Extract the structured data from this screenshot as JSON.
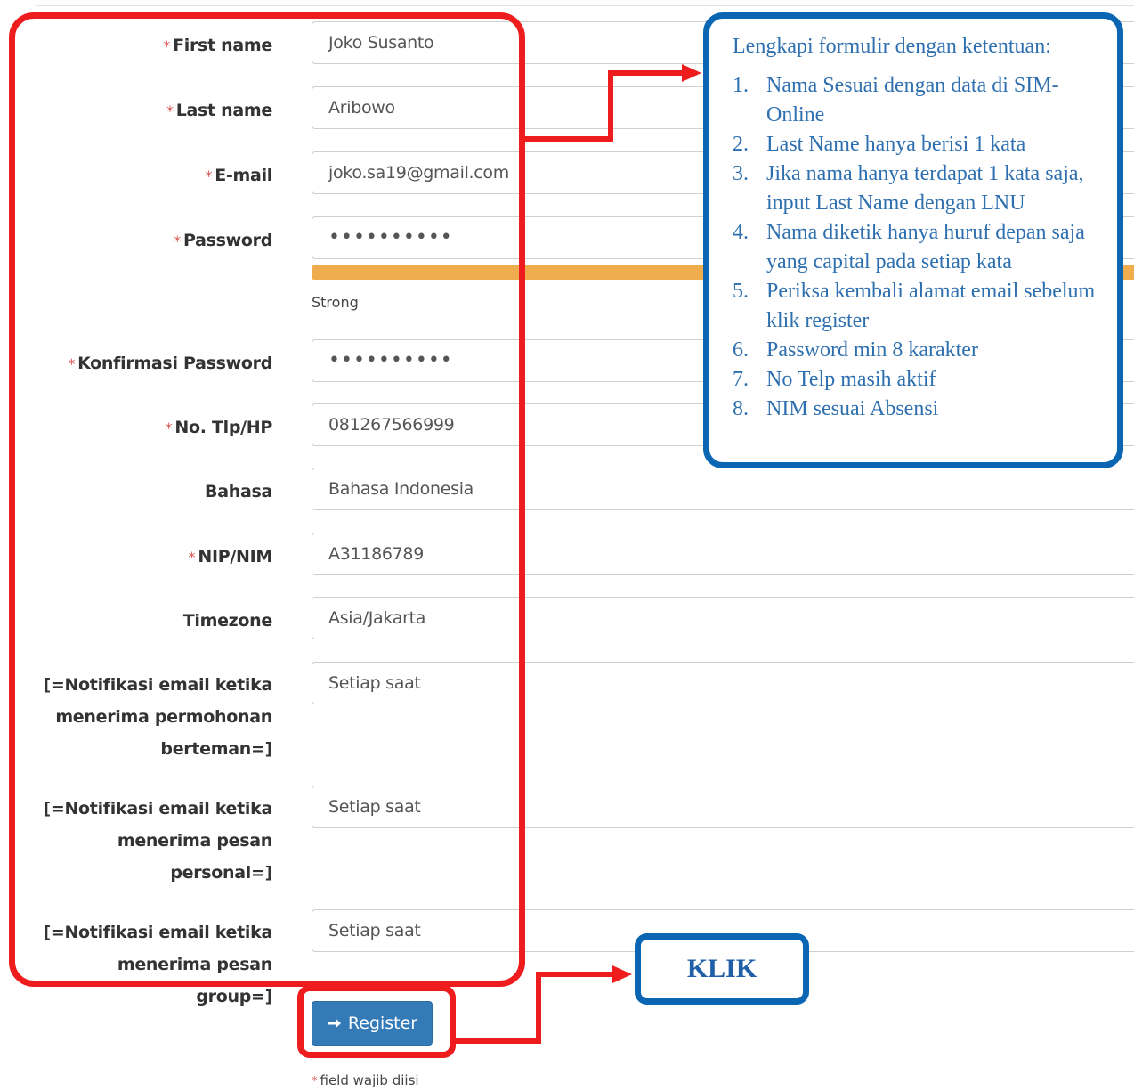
{
  "form": {
    "fields": [
      {
        "label": "First name",
        "required": true,
        "value": "Joko Susanto"
      },
      {
        "label": "Last name",
        "required": true,
        "value": "Aribowo"
      },
      {
        "label": "E-mail",
        "required": true,
        "value": "joko.sa19@gmail.com"
      },
      {
        "label": "Password",
        "required": true,
        "value": "••••••••••"
      },
      {
        "label": "Konfirmasi Password",
        "required": true,
        "value": "••••••••••"
      },
      {
        "label": "No. Tlp/HP",
        "required": true,
        "value": "081267566999"
      },
      {
        "label": "Bahasa",
        "required": false,
        "value": "Bahasa Indonesia"
      },
      {
        "label": "NIP/NIM",
        "required": true,
        "value": "A31186789"
      },
      {
        "label": "Timezone",
        "required": false,
        "value": "Asia/Jakarta"
      },
      {
        "label_lines": [
          "[=Notifikasi email ketika",
          "menerima permohonan",
          "berteman=]"
        ],
        "value": "Setiap saat"
      },
      {
        "label_lines": [
          "[=Notifikasi email ketika",
          "menerima pesan",
          "personal=]"
        ],
        "value": "Setiap saat"
      },
      {
        "label_lines": [
          "[=Notifikasi email ketika",
          "menerima pesan group=]"
        ],
        "value": "Setiap saat"
      }
    ],
    "password_strength": "Strong",
    "password_strength_fraction": 1.0,
    "register_label": "Register",
    "footnote": "field wajib diisi",
    "required_mark": "*"
  },
  "annotation": {
    "heading": "Lengkapi formulir dengan ketentuan:",
    "items": [
      "Nama Sesuai dengan data di SIM-Online",
      "Last Name hanya berisi 1 kata",
      "Jika nama hanya terdapat 1 kata saja, input Last Name dengan LNU",
      "Nama diketik hanya huruf depan saja yang capital pada setiap kata",
      "Periksa kembali alamat email sebelum klik register",
      "Password min 8 karakter",
      "No Telp masih aktif",
      "NIM sesuai Absensi"
    ],
    "klik": "KLIK"
  },
  "colors": {
    "red_frame": "#ee1c1c",
    "blue_frame": "#0a66b3",
    "button": "#337ab7",
    "strength_bar": "#f0ad4e",
    "required": "#d9534f"
  }
}
